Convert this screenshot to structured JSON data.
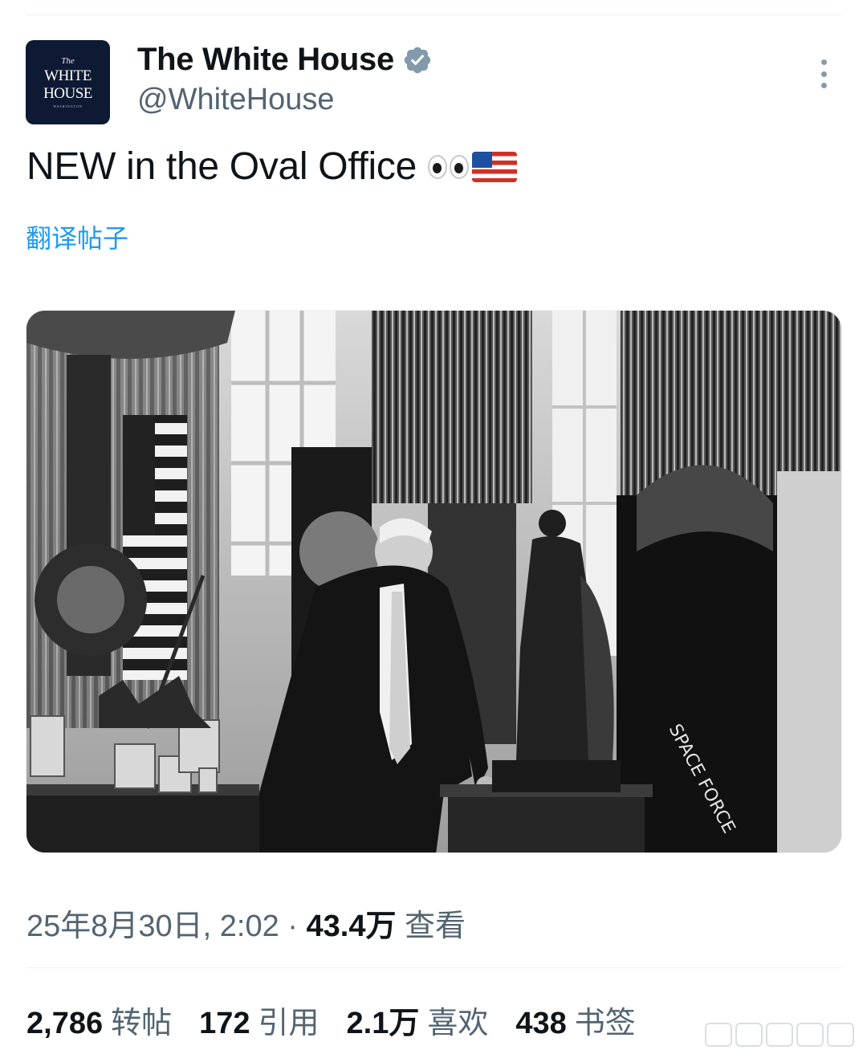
{
  "account": {
    "display_name": "The White House",
    "handle": "@WhiteHouse",
    "avatar": {
      "the": "The",
      "line1": "WHITE",
      "line2": "HOUSE",
      "sub": "WASHINGTON"
    },
    "verified_icon": "verified-badge-icon"
  },
  "tweet": {
    "text": "NEW in the Oval Office",
    "emojis": [
      "eyes-emoji",
      "us-flag-emoji"
    ],
    "translate_label": "翻译帖子"
  },
  "media": {
    "icon": "photo",
    "statue_plaque": "SPACE FORCE"
  },
  "meta": {
    "timestamp": "25年8月30日, 2:02",
    "separator": " · ",
    "views_count": "43.4万",
    "views_label": " 查看"
  },
  "stats": [
    {
      "count": "2,786",
      "label": "转帖"
    },
    {
      "count": "172",
      "label": "引用"
    },
    {
      "count": "2.1万",
      "label": "喜欢"
    },
    {
      "count": "438",
      "label": "书签"
    }
  ],
  "colors": {
    "link_blue": "#1d9bf0",
    "secondary_text": "#536471",
    "primary_text": "#0f1419",
    "avatar_bg": "#0e1a33"
  }
}
